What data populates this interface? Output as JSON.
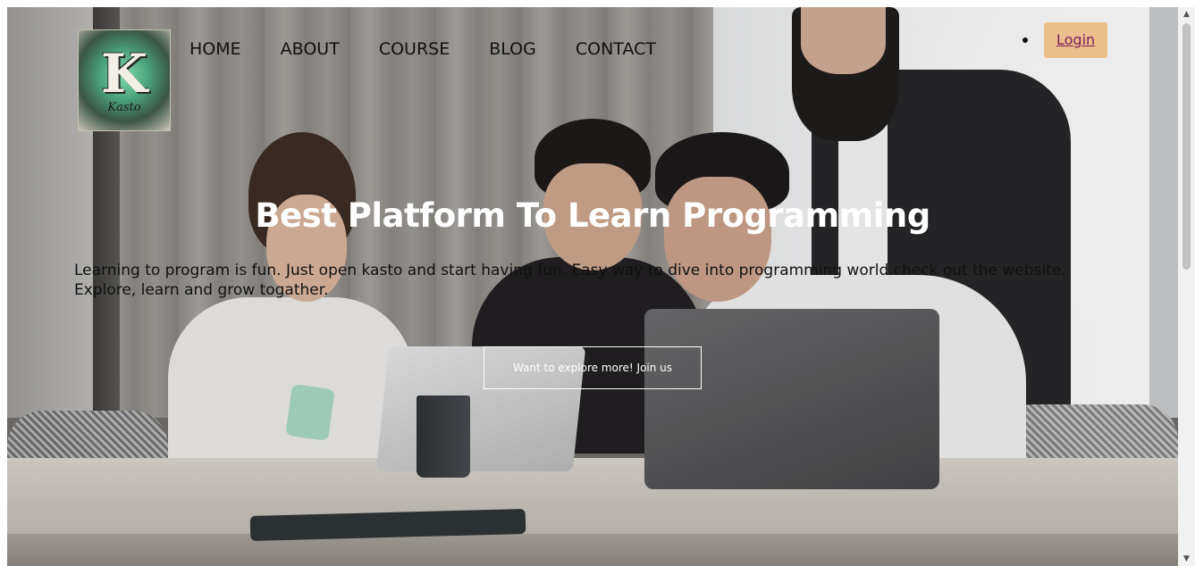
{
  "logo": {
    "letter": "K",
    "script": "Kasto"
  },
  "nav": {
    "items": [
      {
        "label": "HOME"
      },
      {
        "label": "ABOUT"
      },
      {
        "label": "COURSE"
      },
      {
        "label": "BLOG"
      },
      {
        "label": "CONTACT"
      }
    ]
  },
  "header": {
    "login_label": "Login"
  },
  "hero": {
    "title": "Best Platform To Learn Programming",
    "description": "Learning to program is fun. Just open kasto and start having fun. Easy way to dive into programming world.check out the website. Explore, learn and grow togather.",
    "cta_label": "Want to explore more! Join us"
  },
  "colors": {
    "login_bg": "#ecbe8b",
    "login_text": "#7a1f5c",
    "title_text": "#ffffff",
    "body_text": "#111111"
  },
  "scrollbar": {
    "up_icon": "▲",
    "down_icon": "▼"
  }
}
